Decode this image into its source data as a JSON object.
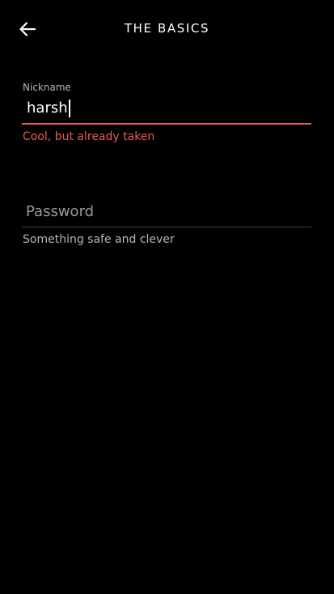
{
  "header": {
    "title": "THE BASICS",
    "back_icon": "arrow-left-icon"
  },
  "nickname": {
    "label": "Nickname",
    "value": "harsh",
    "error": "Cool, but already taken"
  },
  "password": {
    "placeholder": "Password",
    "helper": "Something safe and clever"
  },
  "colors": {
    "background": "#000000",
    "error": "#e85a4f",
    "text": "#ffffff",
    "muted": "#b5b5b5"
  }
}
